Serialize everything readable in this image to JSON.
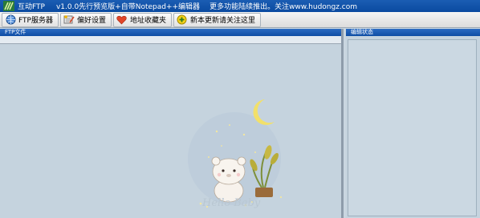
{
  "titlebar": {
    "app_name": "互动FTP",
    "version": "v1.0.0先行预览版+自带Notepad++编辑器",
    "note": "更多功能陆续推出。关注www.hudongz.com"
  },
  "toolbar": {
    "buttons": [
      {
        "label": "FTP服务器",
        "icon": "server-icon"
      },
      {
        "label": "偏好设置",
        "icon": "settings-icon"
      },
      {
        "label": "地址收藏夹",
        "icon": "heart-icon"
      },
      {
        "label": "新本更新请关注这里",
        "icon": "update-icon"
      }
    ]
  },
  "left_panel": {
    "title": "FTP文件",
    "watermark_text": "Hello Baby"
  },
  "right_panel": {
    "title": "编辑状态"
  },
  "colors": {
    "titlebar": "#0a4aa0",
    "panel_header": "#0f4ea5",
    "panel_bg": "#c5d3de"
  }
}
